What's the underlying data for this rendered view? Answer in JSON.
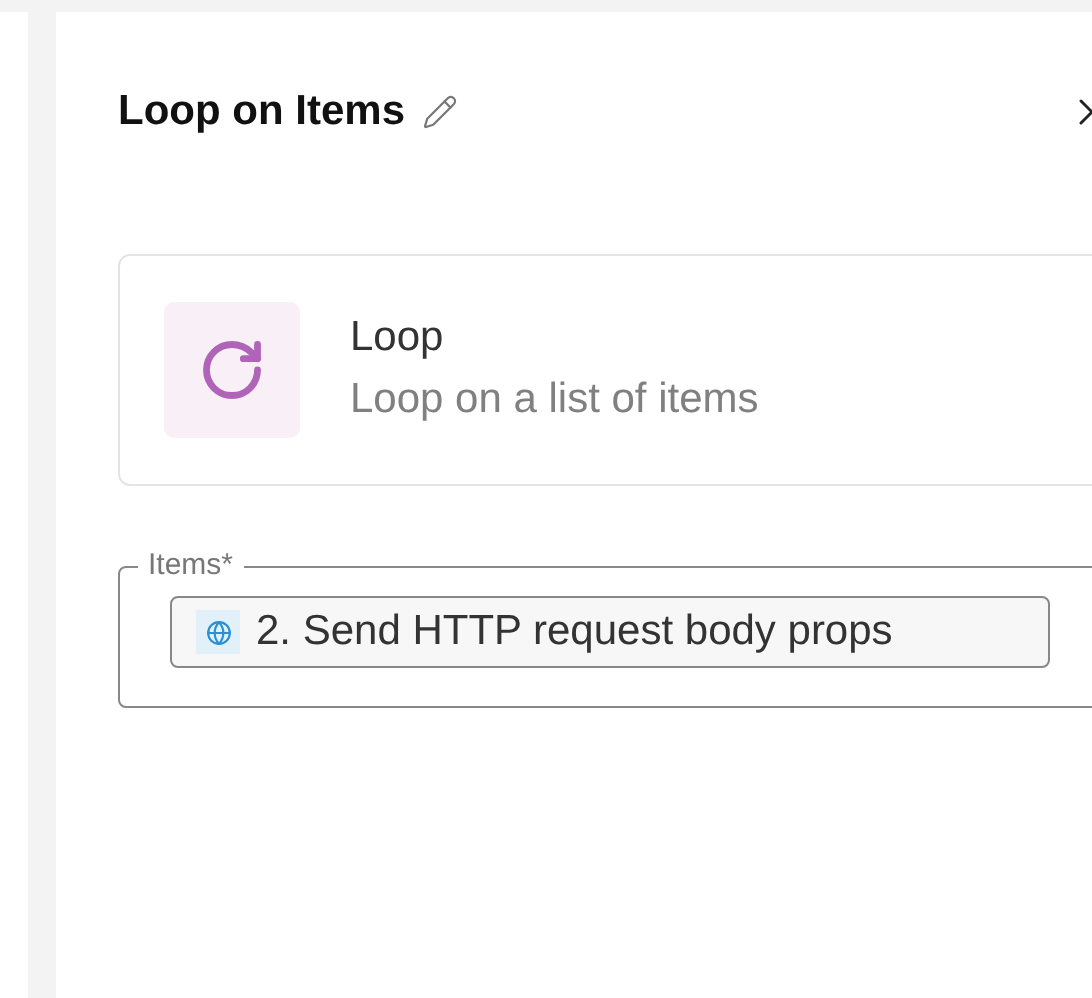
{
  "panel": {
    "title": "Loop on Items"
  },
  "step_card": {
    "name": "Loop",
    "description": "Loop on a list of items"
  },
  "items_field": {
    "label": "Items*",
    "value_chip": "2. Send HTTP request body props"
  }
}
